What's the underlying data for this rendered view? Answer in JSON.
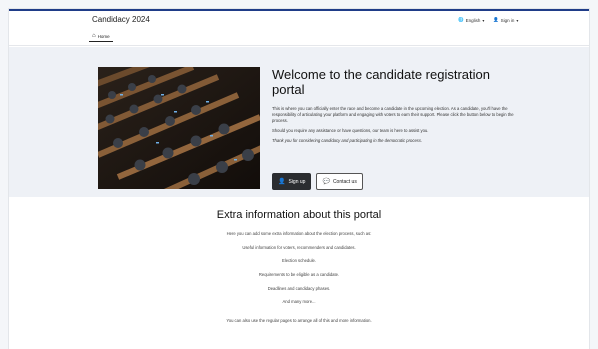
{
  "header": {
    "brand": "Candidacy 2024",
    "language": "English",
    "signin": "Sign in",
    "home_tab": "Home"
  },
  "hero": {
    "title": "Welcome to the candidate registration portal",
    "p1": "This is where you can officially enter the race and become a candidate in the upcoming election. As a candidate, you'll have the responsibility of articulating your platform and engaging with voters to earn their support. Please click the button below to begin the process.",
    "p2": "Should you require any assistance or have questions, our team is here to assist you.",
    "p3": "Thank you for considering candidacy and participating in the democratic process.",
    "signup_label": "Sign up",
    "contact_label": "Contact us"
  },
  "extra": {
    "title": "Extra information about this portal",
    "lines": [
      "Here you can add some extra information about the election process, such as:",
      "Useful information for voters, recommenders and candidates.",
      "Election schedule.",
      "Requirements to be eligible as a candidate.",
      "Deadlines and candidacy phases.",
      "And many more...",
      "You can also use the regular pages to arrange all of this and more information."
    ]
  }
}
